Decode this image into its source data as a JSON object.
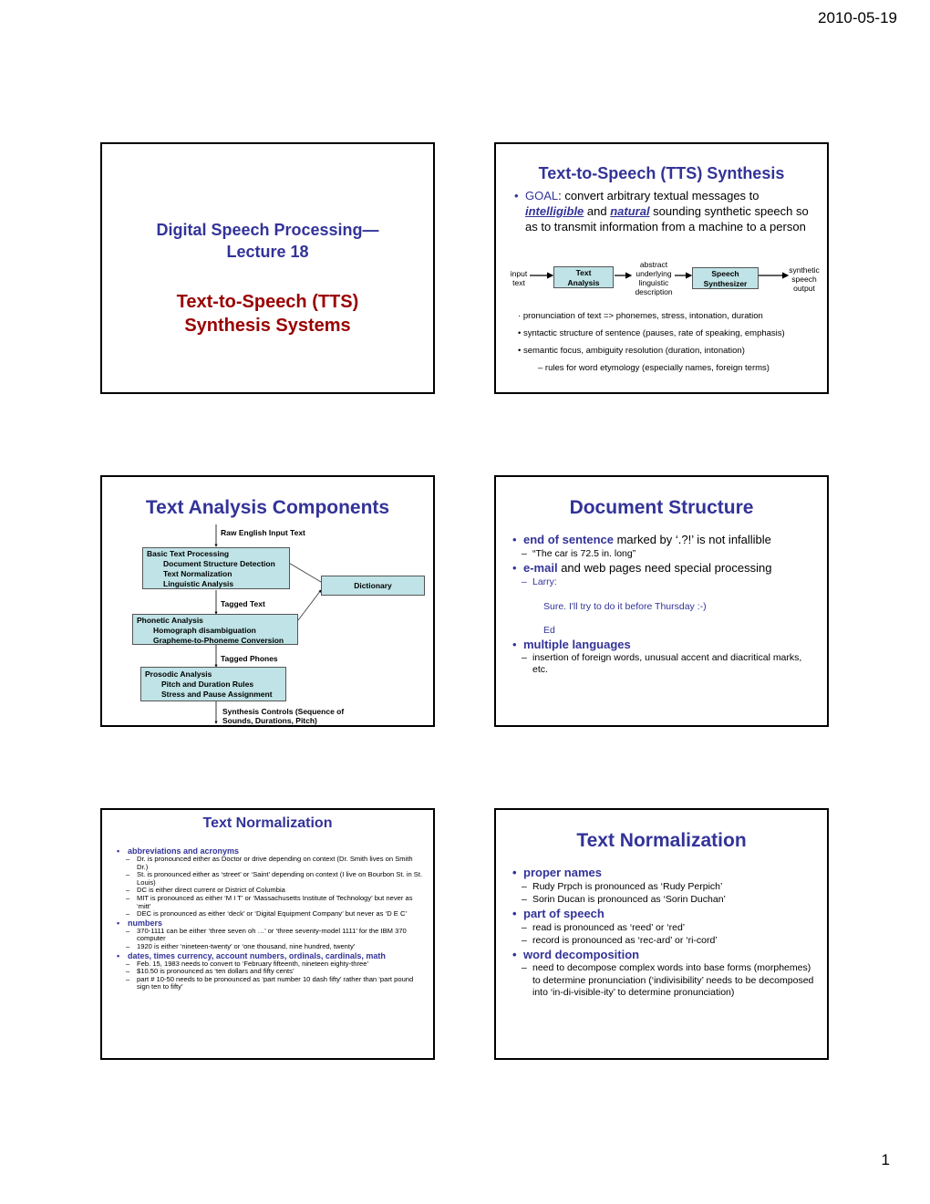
{
  "page": {
    "date": "2010-05-19",
    "number": "1"
  },
  "slide1": {
    "title_line1": "Digital Speech Processing—",
    "title_line2": "Lecture 18",
    "subtitle_line1": "Text-to-Speech (TTS)",
    "subtitle_line2": "Synthesis Systems"
  },
  "slide2": {
    "title": "Text-to-Speech (TTS) Synthesis",
    "goal_label": "GOAL",
    "goal_text_1": ": convert arbitrary textual messages to",
    "intelligible": "intelligible",
    "and": " and ",
    "natural": "natural",
    "goal_text_2": " sounding synthetic speech so as to transmit information from a machine to a person",
    "diagram": {
      "input_line1": "input",
      "input_line2": "text",
      "box1_line1": "Text",
      "box1_line2": "Analysis",
      "mid_line1": "abstract",
      "mid_line2": "underlying",
      "mid_line3": "linguistic",
      "mid_line4": "description",
      "box2_line1": "Speech",
      "box2_line2": "Synthesizer",
      "output_line1": "synthetic",
      "output_line2": "speech",
      "output_line3": "output"
    },
    "points": [
      "pronunciation of text => phonemes, stress, intonation, duration",
      "syntactic structure of sentence (pauses, rate of speaking, emphasis)",
      "semantic focus, ambiguity resolution (duration, intonation)"
    ],
    "subpoint": "– rules for word etymology (especially names, foreign terms)"
  },
  "slide3": {
    "title": "Text Analysis Components",
    "raw_input": "Raw English Input Text",
    "basic": {
      "head": "Basic Text Processing",
      "items": [
        "Document Structure Detection",
        "Text Normalization",
        "Linguistic Analysis"
      ]
    },
    "dictionary": "Dictionary",
    "tagged_text": "Tagged Text",
    "phonetic": {
      "head": "Phonetic Analysis",
      "items": [
        "Homograph disambiguation",
        "Grapheme-to-Phoneme Conversion"
      ]
    },
    "tagged_phones": "Tagged Phones",
    "prosodic": {
      "head": "Prosodic Analysis",
      "items": [
        "Pitch and Duration Rules",
        "Stress and Pause Assignment"
      ]
    },
    "controls_line1": "Synthesis Controls (Sequence of",
    "controls_line2": "Sounds, Durations, Pitch)"
  },
  "slide4": {
    "title": "Document Structure",
    "b1_bold": "end of sentence",
    "b1_rest": " marked by ‘.?!’ is not infallible",
    "b1_sub": "“The car is 72.5 in. long”",
    "b2_bold": "e-mail",
    "b2_rest": " and web pages need special processing",
    "email_greeting": "Larry:",
    "email_body": "Sure.  I'll try to do it before Thursday :-)",
    "email_sign": "Ed",
    "b3_bold": "multiple languages",
    "b3_sub": "insertion of foreign words, unusual accent and diacritical marks, etc."
  },
  "slide5": {
    "title": "Text Normalization",
    "sections": [
      {
        "head": "abbreviations and acronyms",
        "items": [
          "Dr. is pronounced either as Doctor or drive depending on context (Dr. Smith lives on Smith Dr.)",
          "St. is pronounced either as ‘street’ or ‘Saint’ depending on context (I live on Bourbon St. in St. Louis)",
          "DC is either direct current or District of Columbia",
          "MIT is pronounced as either ‘M I T’ or ‘Massachusetts Institute of Technology’ but never as ‘mitt’",
          "DEC is pronounced as either ‘deck’ or ‘Digital Equipment Company’ but never as ‘D E C’"
        ]
      },
      {
        "head": "numbers",
        "items": [
          "370-1111 can be either ‘three seven oh …’ or ‘three seventy-model 1111’ for the IBM 370 computer",
          "1920 is either ‘nineteen-twenty’ or ‘one thousand, nine hundred, twenty’"
        ]
      },
      {
        "head": "dates, times currency, account numbers, ordinals, cardinals, math",
        "items": [
          "Feb. 15, 1983 needs to convert to ‘February fifteenth, nineteen eighty-three’",
          "$10.50 is pronounced as ‘ten dollars and fifty cents’",
          "part # 10-50 needs to be pronounced as ‘part number 10 dash fifty’ rather than ‘part pound sign ten to fifty’"
        ]
      }
    ]
  },
  "slide6": {
    "title": "Text Normalization",
    "sections": [
      {
        "head": "proper names",
        "items": [
          "Rudy Prpch is pronounced as ‘Rudy Perpich’",
          "Sorin Ducan is pronounced as ‘Sorin Duchan’"
        ]
      },
      {
        "head": "part of speech",
        "items": [
          "read is pronounced as ‘reed’ or ‘red’",
          "record is pronounced as ‘rec-ard’ or ‘ri-cord’"
        ]
      },
      {
        "head": "word decomposition",
        "items": [
          "need to decompose complex words into base forms (morphemes) to determine pronunciation (‘indivisibility’ needs to be decomposed into ‘in-di-visible-ity’ to determine pronunciation)"
        ]
      }
    ]
  }
}
